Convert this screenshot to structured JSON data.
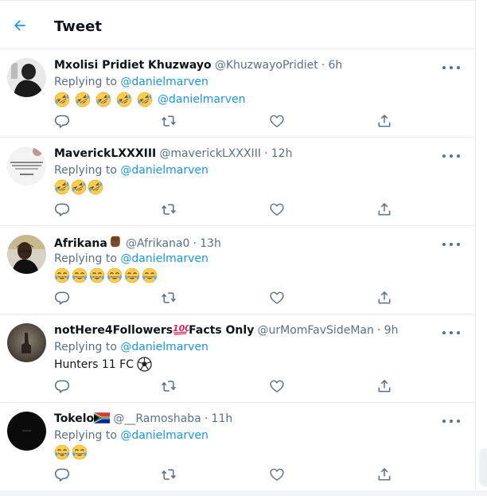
{
  "header": {
    "title": "Tweet"
  },
  "colors": {
    "accent": "#1b95e0",
    "secondary_text": "#5b7083",
    "divider": "#e6ecf0"
  },
  "reply_prefix": "Replying to",
  "tweets": [
    {
      "name": "Mxolisi Pridiet Khuzwayo",
      "name_emoji": "",
      "handle": "@KhuzwayoPridiet",
      "time": "6h",
      "reply_to": "@danielmarven",
      "emojis": [
        "rofl",
        "rofl",
        "rofl",
        "rofl",
        "rofl"
      ],
      "text": "",
      "mention": "@danielmarven"
    },
    {
      "name": "MaverickLXXXIII",
      "name_emoji": "",
      "handle": "@maverickLXXXIII",
      "time": "12h",
      "reply_to": "@danielmarven",
      "emojis": [
        "rofl",
        "rofl",
        "rofl"
      ],
      "text": "",
      "mention": ""
    },
    {
      "name": "Afrikana",
      "name_emoji": "raised-fist",
      "handle": "@Afrikana0",
      "time": "13h",
      "reply_to": "@danielmarven",
      "emojis": [
        "joy",
        "joy",
        "joy",
        "joy",
        "joy",
        "joy"
      ],
      "text": "",
      "mention": ""
    },
    {
      "name": "notHere4Followers",
      "name_emoji": "hundred",
      "name_suffix": "Facts Only",
      "handle": "@urMomFavSideMan",
      "time": "9h",
      "reply_to": "@danielmarven",
      "emojis": [],
      "text": "Hunters 11 FC",
      "text_emoji": "soccer",
      "mention": ""
    },
    {
      "name": "Tokelo",
      "name_emoji": "sa-flag",
      "handle": "@__Ramoshaba",
      "time": "11h",
      "reply_to": "@danielmarven",
      "emojis": [
        "joy",
        "joy"
      ],
      "text": "",
      "mention": ""
    }
  ]
}
